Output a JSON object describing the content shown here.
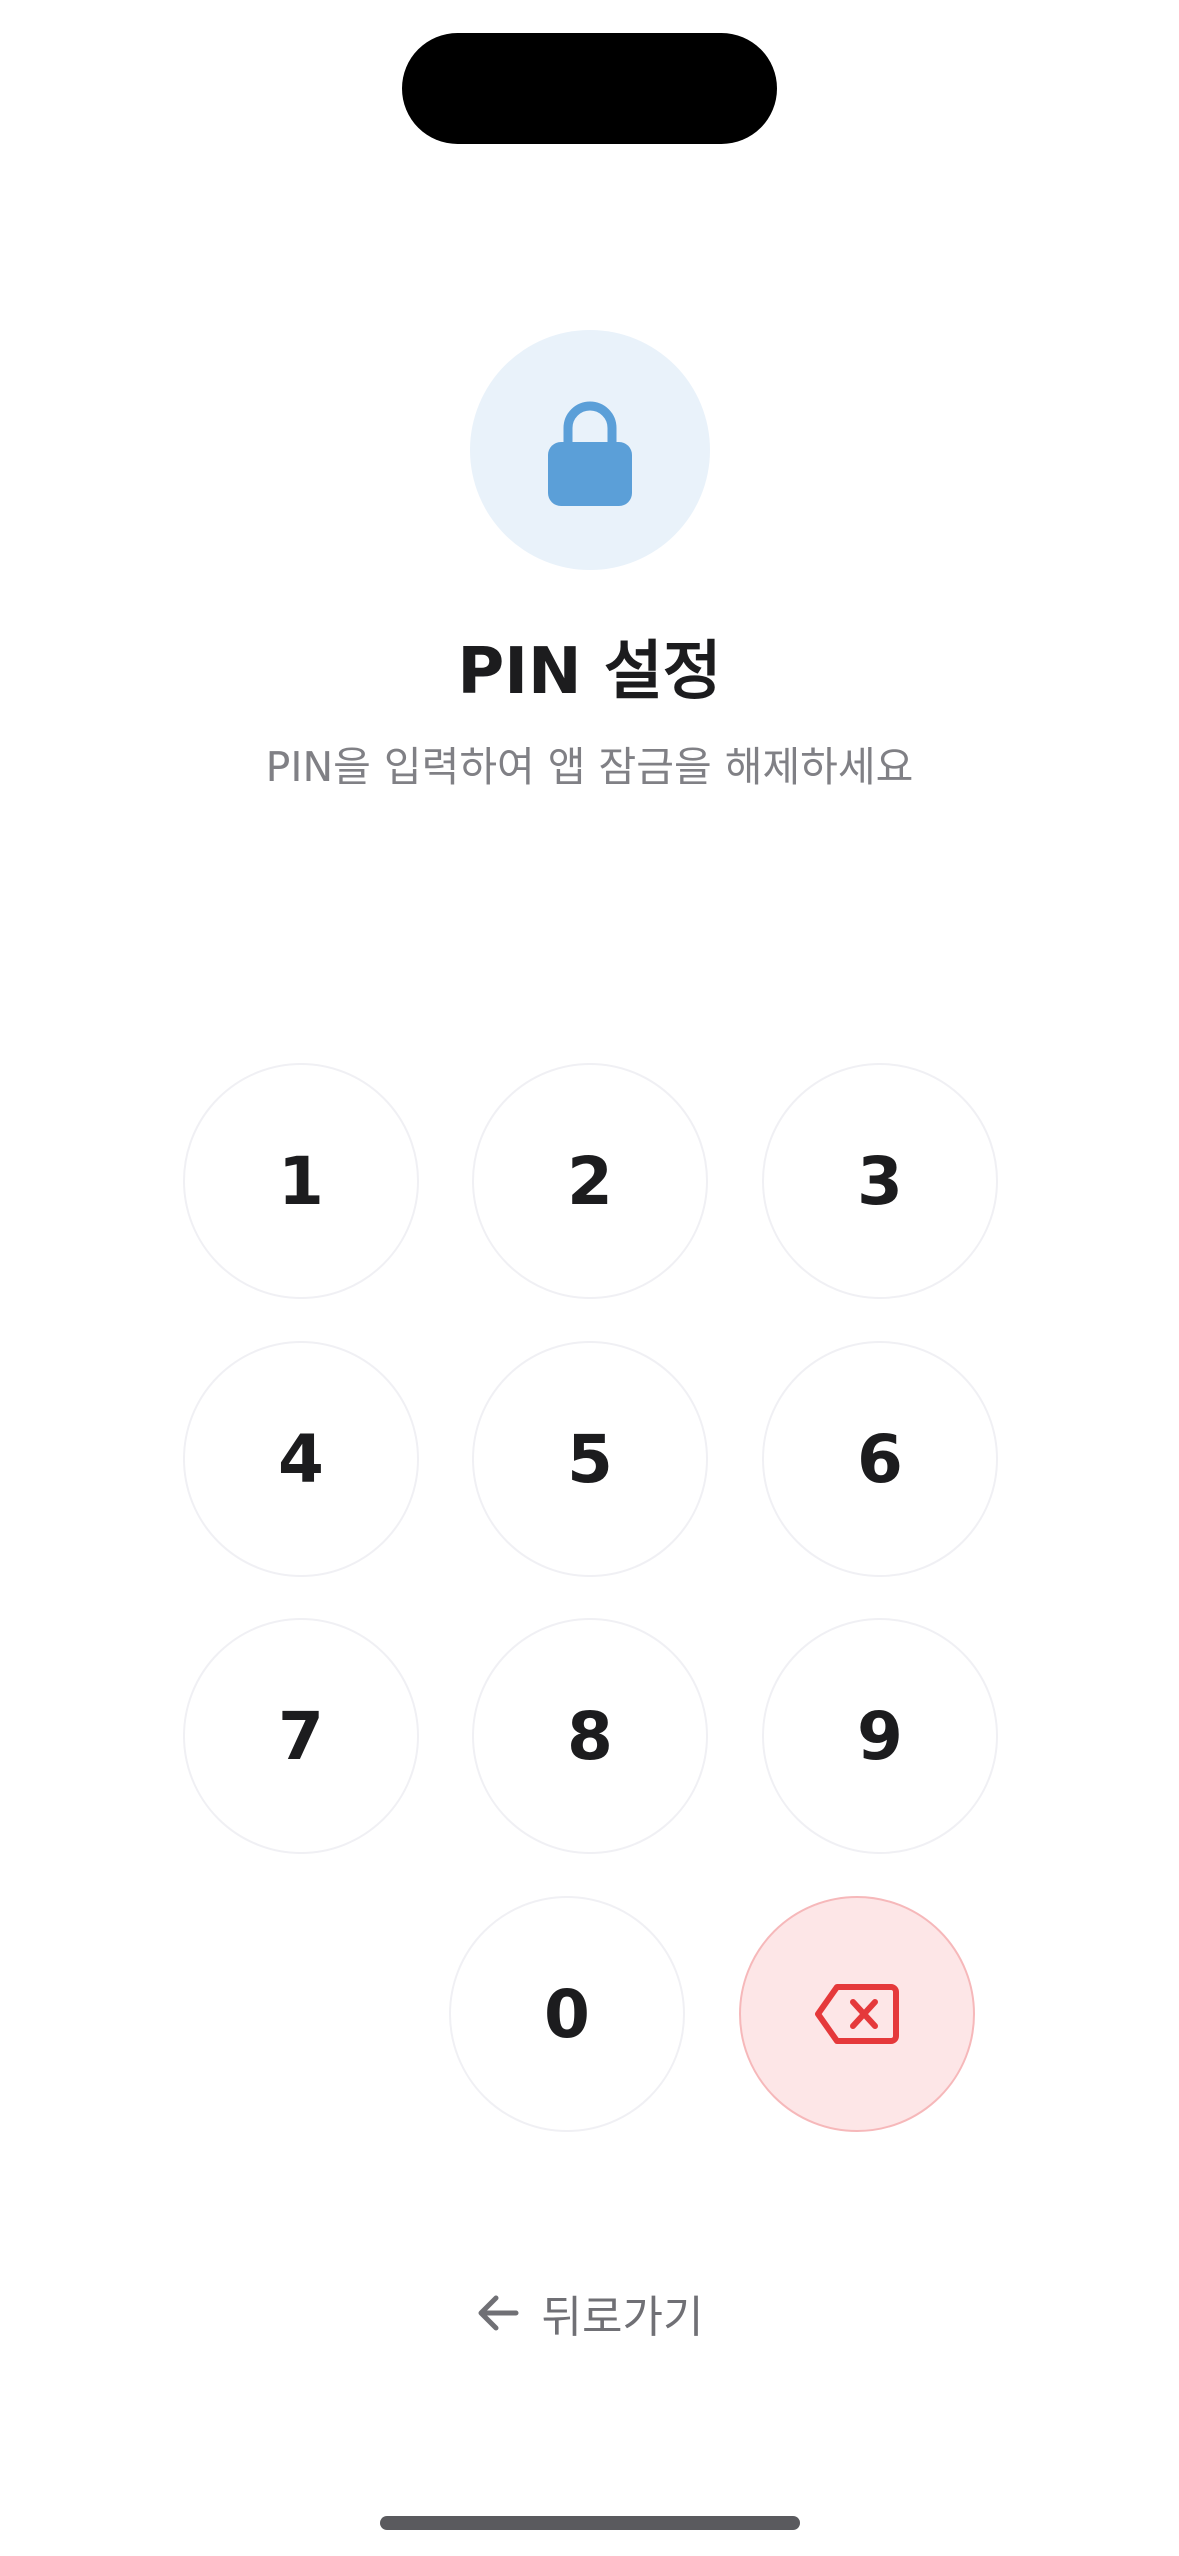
{
  "header": {
    "icon": "lock-icon",
    "title": "PIN 설정",
    "subtitle": "PIN을 입력하여 앱 잠금을 해제하세요"
  },
  "keypad": {
    "keys": [
      "1",
      "2",
      "3",
      "4",
      "5",
      "6",
      "7",
      "8",
      "9",
      "0"
    ],
    "delete_icon": "backspace-icon"
  },
  "footer": {
    "back_icon": "arrow-left-icon",
    "back_label": "뒤로가기"
  },
  "colors": {
    "accent": "#5b9fd8",
    "accent_bg": "#e9f2fa",
    "delete": "#e5393b",
    "delete_bg": "#fde6e7"
  }
}
